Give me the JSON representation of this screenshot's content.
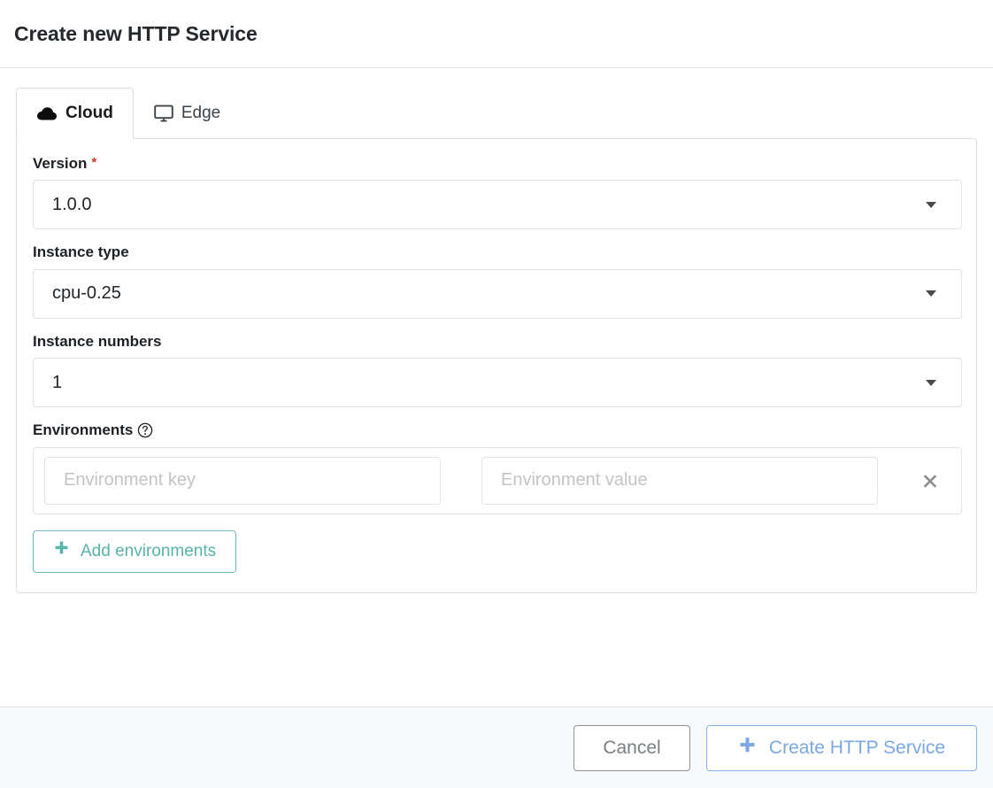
{
  "header": {
    "title": "Create new HTTP Service"
  },
  "tabs": [
    {
      "label": "Cloud",
      "icon": "cloud-icon",
      "active": true
    },
    {
      "label": "Edge",
      "icon": "monitor-icon",
      "active": false
    }
  ],
  "form": {
    "version": {
      "label": "Version",
      "required_marker": "*",
      "value": "1.0.0"
    },
    "instance_type": {
      "label": "Instance type",
      "value": "cpu-0.25"
    },
    "instance_numbers": {
      "label": "Instance numbers",
      "value": "1"
    },
    "environments": {
      "label": "Environments",
      "help_icon": "question-circle-icon",
      "rows": [
        {
          "key_value": "",
          "key_placeholder": "Environment key",
          "value_value": "",
          "value_placeholder": "Environment value",
          "remove_icon": "close-icon"
        }
      ],
      "add_button": {
        "label": "Add environments",
        "icon": "plus-icon"
      }
    }
  },
  "footer": {
    "cancel_label": "Cancel",
    "create_label": "Create HTTP Service",
    "create_icon": "plus-icon"
  },
  "colors": {
    "accent_teal": "#57b3ab",
    "accent_blue": "#7ba7e2",
    "required_red": "#d0342c",
    "footer_bg": "#f7f9fb",
    "border": "#dedede"
  }
}
